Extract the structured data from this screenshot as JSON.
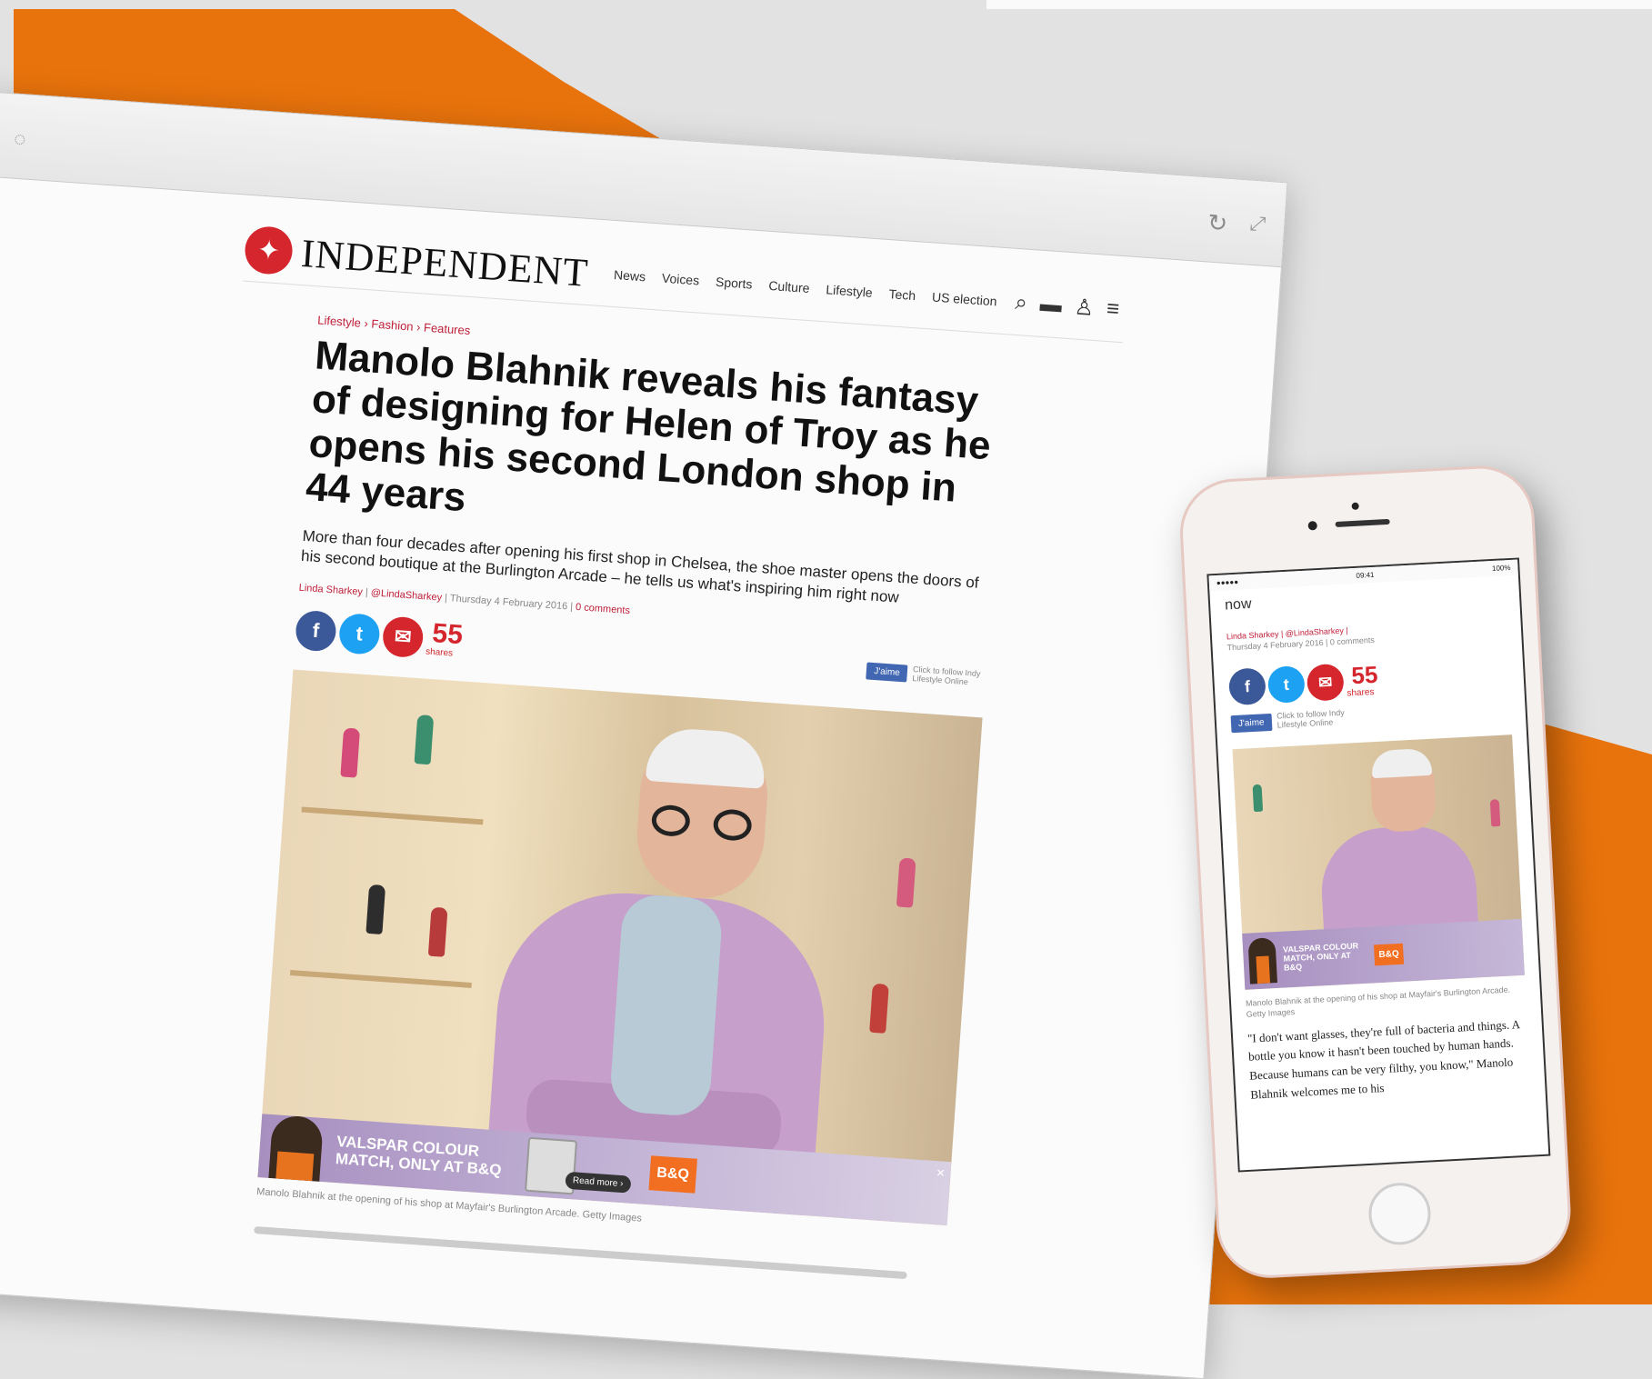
{
  "colors": {
    "accent_orange": "#e8730c",
    "brand_red": "#d4262c",
    "facebook": "#3b5998",
    "twitter": "#1da1f2"
  },
  "desktop": {
    "logo_text": "INDEPENDENT",
    "nav": [
      "News",
      "Voices",
      "Sports",
      "Culture",
      "Lifestyle",
      "Tech",
      "US election"
    ],
    "breadcrumb": "Lifestyle › Fashion › Features",
    "headline": "Manolo Blahnik reveals his fantasy of designing for Helen of Troy as he opens his second London shop in 44 years",
    "standfirst": "More than four decades after opening his first shop in Chelsea, the shoe master opens the doors of his second boutique at the Burlington Arcade – he tells us what's inspiring him right now",
    "byline": {
      "author": "Linda Sharkey",
      "handle": "@LindaSharkey",
      "date": "Thursday 4 February 2016",
      "comments": "0 comments"
    },
    "shares_count": "55",
    "shares_label": "shares",
    "like_button": "J'aime",
    "like_note": "Click to follow Indy Lifestyle Online",
    "ad": {
      "text": "VALSPAR COLOUR MATCH, ONLY AT B&Q",
      "read_more": "Read more ›",
      "brand": "B&Q"
    },
    "caption": "Manolo Blahnik at the opening of his shop at Mayfair's Burlington Arcade. Getty Images"
  },
  "phone": {
    "status": {
      "carrier": "●●●●● ",
      "time": "09:41",
      "battery": "100%"
    },
    "top_text": "now",
    "byline_author": "Linda Sharkey | @LindaSharkey |",
    "byline_date": "Thursday 4 February 2016 | 0 comments",
    "shares_count": "55",
    "shares_label": "shares",
    "like_button": "J'aime",
    "like_note": "Click to follow Indy Lifestyle Online",
    "ad_text": "VALSPAR COLOUR MATCH, ONLY AT B&Q",
    "ad_brand": "B&Q",
    "caption": "Manolo Blahnik at the opening of his shop at Mayfair's Burlington Arcade. Getty Images",
    "body": "\"I don't want glasses, they're full of bacteria and things. A bottle you know it hasn't been touched by human hands. Because humans can be very filthy, you know,\" Manolo Blahnik welcomes me to his"
  }
}
